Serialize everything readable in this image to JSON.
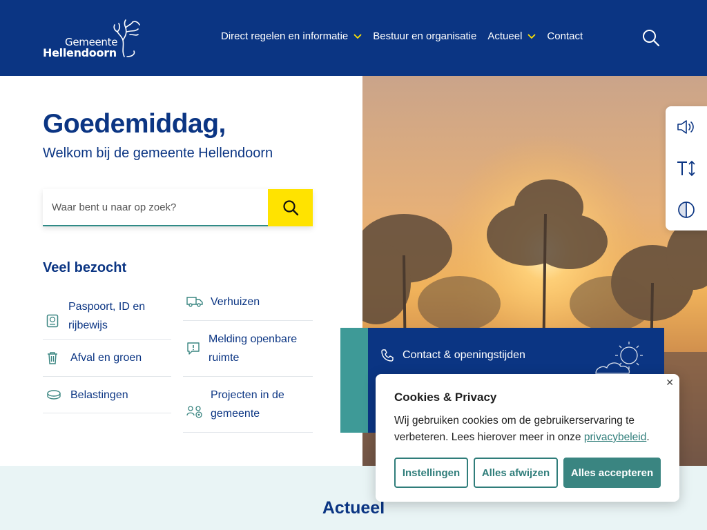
{
  "header": {
    "logo_line1": "Gemeente",
    "logo_line2": "Hellendoorn",
    "nav": [
      {
        "label": "Direct regelen en informatie",
        "has_dropdown": true
      },
      {
        "label": "Bestuur en organisatie",
        "has_dropdown": false
      },
      {
        "label": "Actueel",
        "has_dropdown": true
      },
      {
        "label": "Contact",
        "has_dropdown": false
      }
    ],
    "search_icon": "search-icon"
  },
  "hero": {
    "greeting": "Goedemiddag,",
    "welcome": "Welkom bij de gemeente Hellendoorn",
    "search_placeholder": "Waar bent u naar op zoek?"
  },
  "most_visited": {
    "title": "Veel bezocht",
    "left": [
      {
        "label": "Paspoort, ID en rijbewijs",
        "icon": "passport-icon"
      },
      {
        "label": "Afval en groen",
        "icon": "trash-icon"
      },
      {
        "label": "Belastingen",
        "icon": "coins-icon"
      }
    ],
    "right": [
      {
        "label": "Verhuizen",
        "icon": "truck-icon"
      },
      {
        "label": "Melding openbare ruimte",
        "icon": "report-icon"
      },
      {
        "label": "Projecten in de gemeente",
        "icon": "people-icon"
      }
    ]
  },
  "side_tools": [
    "read-aloud-icon",
    "text-size-icon",
    "contrast-icon"
  ],
  "contact_card": {
    "link_label": "Contact & openingstijden",
    "icon": "phone-icon"
  },
  "actueel": {
    "title": "Actueel"
  },
  "cookie": {
    "title": "Cookies & Privacy",
    "text_before": "Wij gebruiken cookies om de gebruikerservaring te verbeteren. Lees hierover meer in onze ",
    "link": "privacybeleid",
    "text_after": ".",
    "close": "✕",
    "buttons": {
      "settings": "Instellingen",
      "reject": "Alles afwijzen",
      "accept": "Alles accepteren"
    }
  },
  "colors": {
    "brand_blue": "#0b3583",
    "teal": "#3a8581",
    "yellow": "#ffe300",
    "light_band": "#e9f4f5"
  }
}
